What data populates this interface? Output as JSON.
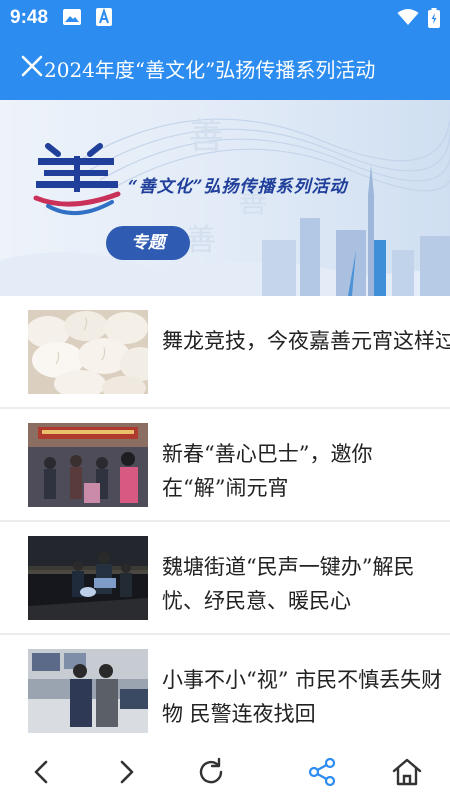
{
  "status_bar": {
    "time": "9:48"
  },
  "app_bar": {
    "title": "2024年度“善文化”弘扬传播系列活动"
  },
  "banner": {
    "title": "“善文化”弘扬传播系列活动",
    "badge": "专题",
    "logo_char": "善"
  },
  "news": [
    {
      "title": "舞龙竞技，今夜嘉善元宵这样过"
    },
    {
      "title": "新春“善心巴士”，邀你在“解”闹元宵"
    },
    {
      "title": "魏塘街道“民声一键办”解民忧、纾民意、暖民心"
    },
    {
      "title": "小事不小“视” 市民不慎丢失财物 民警连夜找回"
    }
  ],
  "colors": {
    "primary": "#2c8cf0"
  }
}
